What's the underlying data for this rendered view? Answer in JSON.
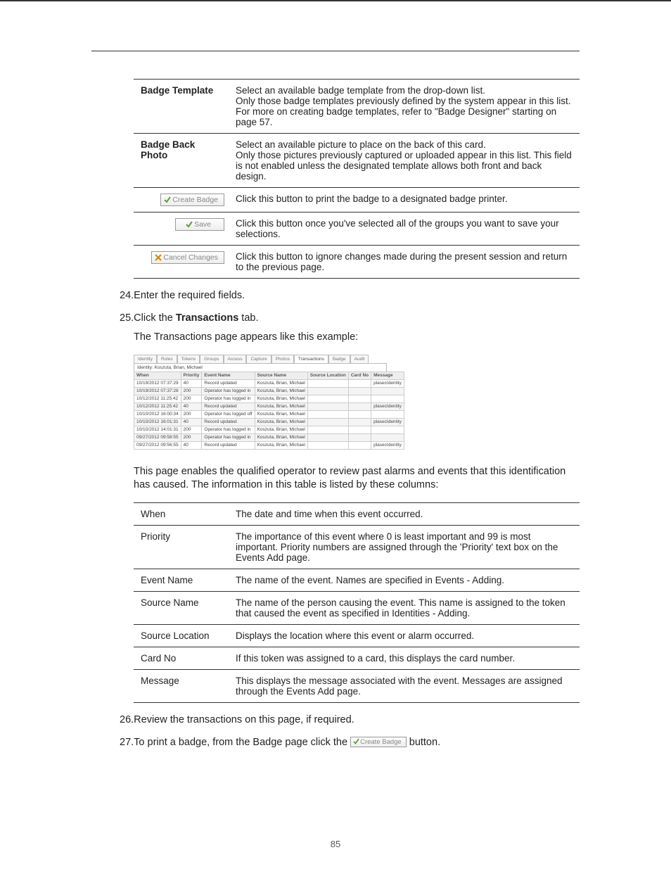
{
  "page_number": "85",
  "table1": {
    "rows": [
      {
        "label": "Badge Template",
        "desc": "Select an available badge template from the drop-down list.\nOnly those badge templates previously defined by the system appear in this list. For more on creating badge templates, refer to \"Badge Designer\" starting on page 57."
      },
      {
        "label": "Badge Back Photo",
        "desc": "Select an available picture to place on the back of this card.\nOnly those pictures previously captured or uploaded appear in this list. This field is not enabled unless the designated template allows both front and back design."
      }
    ],
    "btn_rows": [
      {
        "btn": "Create Badge",
        "icon": "check",
        "desc": "Click this button to print the badge to a designated badge printer."
      },
      {
        "btn": "Save",
        "icon": "check",
        "desc": "Click this button once you've selected all of the groups you want to save your selections."
      },
      {
        "btn": "Cancel Changes",
        "icon": "x",
        "desc": "Click this button to ignore changes made during the present session and return to the previous page."
      }
    ]
  },
  "steps": {
    "s24": {
      "num": "24.",
      "text": "Enter the required fields."
    },
    "s25": {
      "num": "25.",
      "text_a": "Click the ",
      "bold": "Transactions",
      "text_b": " tab."
    },
    "s25_body": "The Transactions page appears like this example:",
    "s25_body2": "This page enables the qualified operator to review past alarms and events that this identification has caused. The information in this table is listed by these columns:",
    "s26": {
      "num": "26.",
      "text": "Review the transactions on this page, if required."
    },
    "s27": {
      "num": "27.",
      "text_a": "To print a badge, from the Badge page click the ",
      "btn": "Create Badge",
      "text_b": " button."
    }
  },
  "screenshot": {
    "tabs": [
      "Identity",
      "Roles",
      "Tokens",
      "Groups",
      "Access",
      "Capture",
      "Photos",
      "Transactions",
      "Badge",
      "Audit"
    ],
    "active_tab": "Transactions",
    "identity_line": "Identity: Koszuta, Brian, Michael",
    "headers": [
      "When",
      "Priority",
      "Event Name",
      "Source Name",
      "Source Location",
      "Card No",
      "Message"
    ],
    "rows": [
      [
        "10/19/2012 07:37:29",
        "40",
        "Record updated",
        "Koszuta, Brian, Michael",
        "",
        "",
        "plasecIdentity"
      ],
      [
        "10/19/2012 07:37:28",
        "200",
        "Operator has logged in",
        "Koszuta, Brian, Michael",
        "",
        "",
        ""
      ],
      [
        "10/12/2012 11:25:42",
        "200",
        "Operator has logged in",
        "Koszuta, Brian, Michael",
        "",
        "",
        ""
      ],
      [
        "10/12/2012 11:25:42",
        "40",
        "Record updated",
        "Koszuta, Brian, Michael",
        "",
        "",
        "plasecIdentity"
      ],
      [
        "10/10/2012 16:00:34",
        "200",
        "Operator has logged off",
        "Koszuta, Brian, Michael",
        "",
        "",
        ""
      ],
      [
        "10/10/2012 16:01:31",
        "40",
        "Record updated",
        "Koszuta, Brian, Michael",
        "",
        "",
        "plasecIdentity"
      ],
      [
        "10/10/2012 14:01:31",
        "200",
        "Operator has logged in",
        "Koszuta, Brian, Michael",
        "",
        "",
        ""
      ],
      [
        "09/27/2012 09:58:55",
        "200",
        "Operator has logged in",
        "Koszuta, Brian, Michael",
        "",
        "",
        ""
      ],
      [
        "09/27/2012 09:56:55",
        "40",
        "Record updated",
        "Koszuta, Brian, Michael",
        "",
        "",
        "plasecIdentity"
      ]
    ]
  },
  "table2": {
    "rows": [
      {
        "label": "When",
        "desc": "The date and time when this event occurred."
      },
      {
        "label": "Priority",
        "desc": "The importance of this event where 0 is least important and 99 is most important. Priority numbers are assigned through the 'Priority' text box on the Events Add page."
      },
      {
        "label": "Event Name",
        "desc": "The name of the event. Names are specified in Events - Adding."
      },
      {
        "label": "Source Name",
        "desc": "The name of the person causing the event. This name is assigned to the token that caused the event as specified in Identities - Adding."
      },
      {
        "label": "Source Location",
        "desc": "Displays the location where this event or alarm occurred."
      },
      {
        "label": "Card No",
        "desc": "If this token was assigned to a card, this displays the card number."
      },
      {
        "label": "Message",
        "desc": "This displays the message associated with the event. Messages are assigned through the Events Add page."
      }
    ]
  }
}
